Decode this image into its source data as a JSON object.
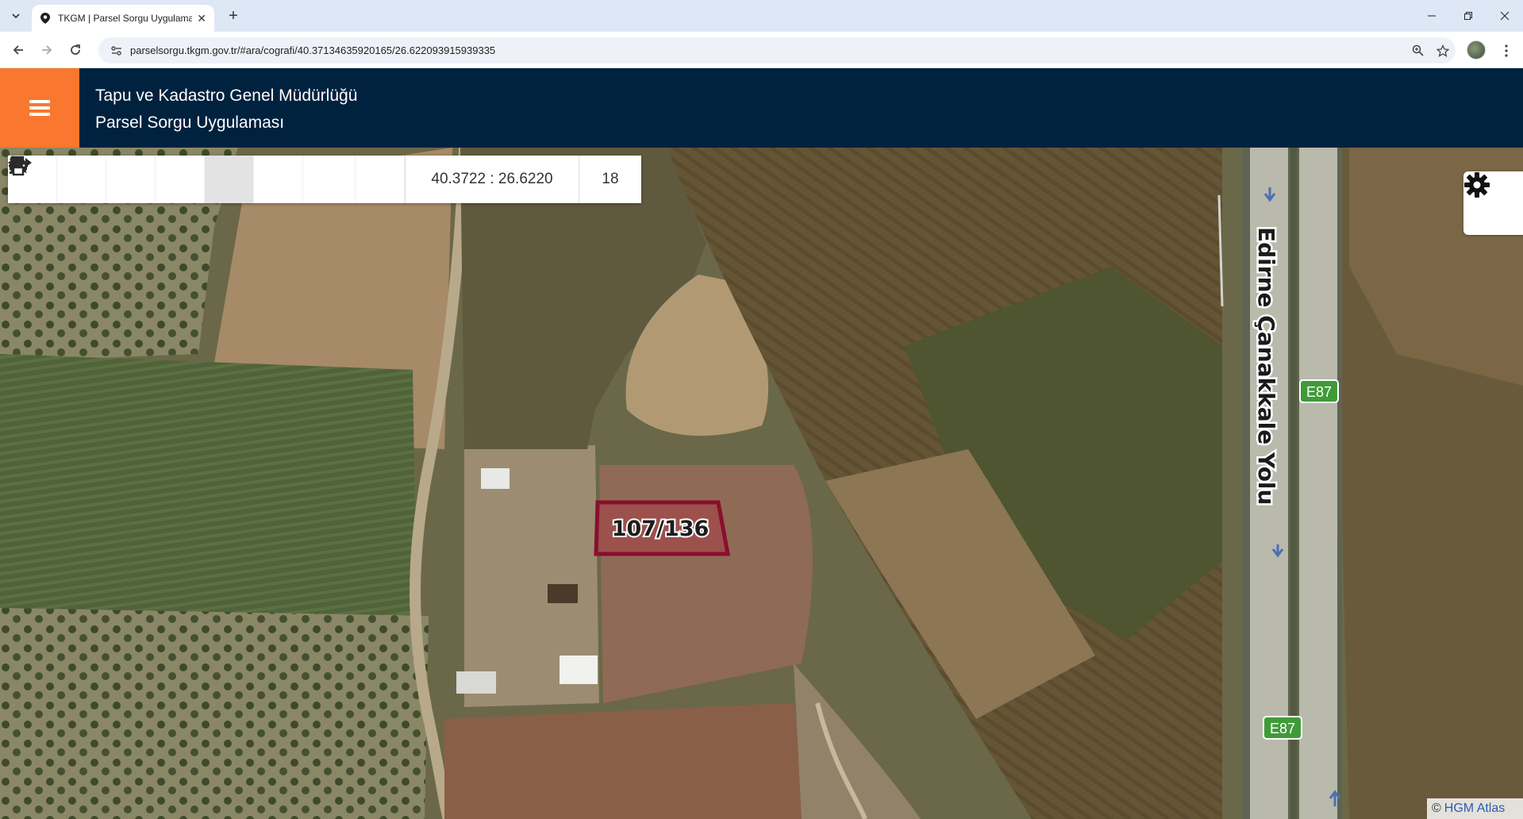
{
  "browser": {
    "tab_title": "TKGM | Parsel Sorgu Uygulama",
    "url": "parselsorgu.tkgm.gov.tr/#ara/cografi/40.37134635920165/26.622093915939335"
  },
  "header": {
    "line1": "Tapu ve Kadastro Genel Müdürlüğü",
    "line2": "Parsel Sorgu Uygulaması"
  },
  "map_toolbar": {
    "buttons": [
      {
        "name": "zoom-in",
        "icon": "plus-icon"
      },
      {
        "name": "zoom-out",
        "icon": "minus-icon"
      },
      {
        "name": "refresh",
        "icon": "refresh-icon"
      },
      {
        "name": "locate",
        "icon": "crosshairs-icon"
      },
      {
        "name": "info",
        "icon": "info-icon",
        "active": true
      },
      {
        "name": "favorite",
        "icon": "star-icon"
      },
      {
        "name": "measure",
        "icon": "arrows-h-icon"
      },
      {
        "name": "print",
        "icon": "print-icon"
      }
    ],
    "coordinates": "40.3722 : 26.6220",
    "zoom_level": "18"
  },
  "map": {
    "parcel_label": "107/136",
    "road_name": "Edirne Çanakkale Yolu",
    "road_shields": [
      "E87",
      "E87"
    ],
    "attribution_prefix": "©",
    "attribution_link": "HGM Atlas",
    "colors": {
      "parcel_outline": "#8a0e2d",
      "parcel_fill": "#a04a4a",
      "shield_fill": "#3f9b38",
      "header_bg": "#00223f",
      "menu_bg": "#f9772f"
    }
  }
}
